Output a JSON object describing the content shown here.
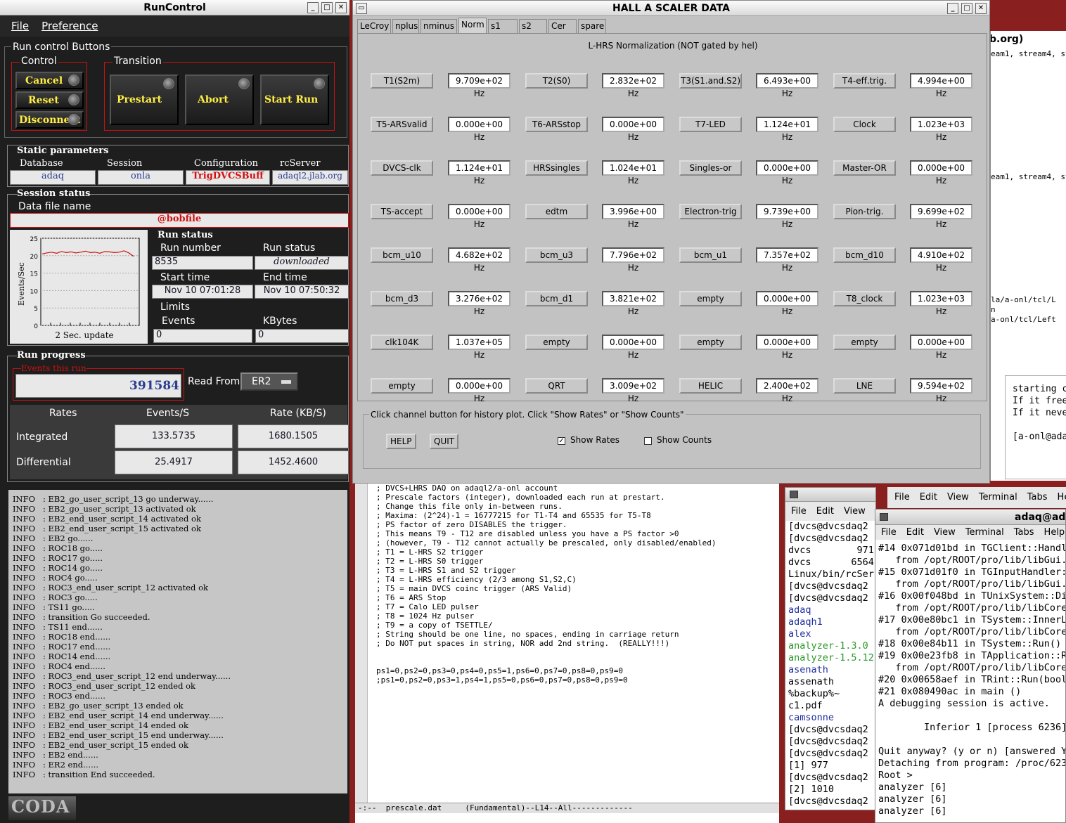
{
  "runcontrol": {
    "title": "RunControl",
    "menu": [
      "File",
      "Preference"
    ],
    "buttons_group": "Run control Buttons",
    "control_label": "Control",
    "transition_label": "Transition",
    "control_buttons": [
      "Cancel",
      "Reset",
      "Disconnect"
    ],
    "transition_buttons": [
      "Prestart",
      "Abort",
      "Start Run"
    ],
    "static_params_label": "Static parameters",
    "params": [
      {
        "label": "Database",
        "value": "adaq"
      },
      {
        "label": "Session",
        "value": "onla"
      },
      {
        "label": "Configuration",
        "value": "TrigDVCSBuff"
      },
      {
        "label": "rcServer",
        "value": "adaql2.jlab.org"
      }
    ],
    "session_status_label": "Session status",
    "data_file_label": "Data file name",
    "data_file_value": "@bobfile",
    "plot": {
      "ylabel": "Events/Sec",
      "ticks": [
        "25",
        "20",
        "15",
        "10",
        "5",
        "0"
      ],
      "caption": "2 Sec. update",
      "values": [
        20.5,
        20.8,
        21.0,
        20.7,
        21.2,
        20.9,
        21.1,
        20.8,
        21.0,
        21.3,
        20.9,
        21.0,
        20.7,
        21.2,
        21.1,
        20.9,
        21.0,
        21.4,
        20.8,
        19.8
      ]
    },
    "run_status_label": "Run status",
    "run_number_label": "Run number",
    "run_number": "8535",
    "run_status_field_label": "Run status",
    "run_status": "downloaded",
    "start_time_label": "Start time",
    "start_time": "Nov 10 07:01:28",
    "end_time_label": "End time",
    "end_time": "Nov 10 07:50:32",
    "limits_label": "Limits",
    "events_label": "Events",
    "events_value": "0",
    "kbytes_label": "KBytes",
    "kbytes_value": "0",
    "run_progress_label": "Run progress",
    "events_this_run_label": "Events this run",
    "events_this_run": "391584",
    "read_from_label": "Read From:",
    "read_from": "ER2",
    "rates_header": [
      "Rates",
      "Events/S",
      "Rate (KB/S)"
    ],
    "rates": [
      {
        "label": "Integrated",
        "events": "133.5735",
        "kb": "1680.1505"
      },
      {
        "label": "Differential",
        "events": "25.4917",
        "kb": "1452.4600"
      }
    ],
    "log": [
      "INFO   : EB2_go_user_script_13 go underway......",
      "INFO   : EB2_go_user_script_13 activated ok",
      "INFO   : EB2_end_user_script_14 activated ok",
      "INFO   : EB2_end_user_script_15 activated ok",
      "INFO   : EB2 go......",
      "INFO   : ROC18 go.....",
      "INFO   : ROC17 go.....",
      "INFO   : ROC14 go.....",
      "INFO   : ROC4 go.....",
      "INFO   : ROC3_end_user_script_12 activated ok",
      "INFO   : ROC3 go.....",
      "INFO   : TS11 go.....",
      "INFO   : transition Go succeeded.",
      "INFO   : TS11 end......",
      "INFO   : ROC18 end......",
      "INFO   : ROC17 end......",
      "INFO   : ROC14 end......",
      "INFO   : ROC4 end......",
      "INFO   : ROC3_end_user_script_12 end underway......",
      "INFO   : ROC3_end_user_script_12 ended ok",
      "INFO   : ROC3 end......",
      "INFO   : EB2_go_user_script_13 ended ok",
      "INFO   : EB2_end_user_script_14 end underway......",
      "INFO   : EB2_end_user_script_14 ended ok",
      "INFO   : EB2_end_user_script_15 end underway......",
      "INFO   : EB2_end_user_script_15 ended ok",
      "INFO   : EB2 end......",
      "INFO   : ER2 end......",
      "INFO   : transition End succeeded."
    ],
    "logo": "CODA"
  },
  "scaler": {
    "title": "HALL  A   SCALER   DATA",
    "tabs": [
      "LeCroy",
      "nplus",
      "nminus",
      "Norm",
      "s1",
      "s2",
      "Cer",
      "spare"
    ],
    "active_tab": "Norm",
    "heading": "L-HRS Normalization (NOT gated by hel)",
    "rows": [
      [
        [
          "T1(S2m)",
          "9.709e+02 Hz"
        ],
        [
          "T2(S0)",
          "2.832e+02 Hz"
        ],
        [
          "T3(S1.and.S2)",
          "6.493e+00 Hz"
        ],
        [
          "T4-eff.trig.",
          "4.994e+00 Hz"
        ]
      ],
      [
        [
          "T5-ARSvalid",
          "0.000e+00 Hz"
        ],
        [
          "T6-ARSstop",
          "0.000e+00 Hz"
        ],
        [
          "T7-LED",
          "1.124e+01 Hz"
        ],
        [
          "Clock",
          "1.023e+03 Hz"
        ]
      ],
      [
        [
          "DVCS-clk",
          "1.124e+01 Hz"
        ],
        [
          "HRSsingles",
          "1.024e+01 Hz"
        ],
        [
          "Singles-or",
          "0.000e+00 Hz"
        ],
        [
          "Master-OR",
          "0.000e+00 Hz"
        ]
      ],
      [
        [
          "TS-accept",
          "0.000e+00 Hz"
        ],
        [
          "edtm",
          "3.996e+00 Hz"
        ],
        [
          "Electron-trig",
          "9.739e+00 Hz"
        ],
        [
          "Pion-trig.",
          "9.699e+02 Hz"
        ]
      ],
      [
        [
          "bcm_u10",
          "4.682e+02 Hz"
        ],
        [
          "bcm_u3",
          "7.796e+02 Hz"
        ],
        [
          "bcm_u1",
          "7.357e+02 Hz"
        ],
        [
          "bcm_d10",
          "4.910e+02 Hz"
        ]
      ],
      [
        [
          "bcm_d3",
          "3.276e+02 Hz"
        ],
        [
          "bcm_d1",
          "3.821e+02 Hz"
        ],
        [
          "empty",
          "0.000e+00 Hz"
        ],
        [
          "T8_clock",
          "1.023e+03 Hz"
        ]
      ],
      [
        [
          "clk104K",
          "1.037e+05 Hz"
        ],
        [
          "empty",
          "0.000e+00 Hz"
        ],
        [
          "empty",
          "0.000e+00 Hz"
        ],
        [
          "empty",
          "0.000e+00 Hz"
        ]
      ],
      [
        [
          "empty",
          "0.000e+00 Hz"
        ],
        [
          "QRT",
          "3.009e+02 Hz"
        ],
        [
          "HELIC",
          "2.400e+02 Hz"
        ],
        [
          "LNE",
          "9.594e+02 Hz"
        ]
      ]
    ],
    "config_note": "Click channel button for history plot.  Click \"Show Rates\" or \"Show Counts\"",
    "help": "HELP",
    "quit": "QUIT",
    "show_rates": "Show Rates",
    "show_counts": "Show Counts"
  },
  "emacs": {
    "lines": [
      "; DVCS+LHRS DAQ on adaql2/a-onl account",
      "; Prescale factors (integer), downloaded each run at prestart.",
      "; Change this file only in-between runs.",
      "; Maxima: (2^24)-1 = 16777215 for T1-T4 and 65535 for T5-T8",
      "; PS factor of zero DISABLES the trigger.",
      "; This means T9 - T12 are disabled unless you have a PS factor >0",
      "; (however, T9 - T12 cannot actually be prescaled, only disabled/enabled)",
      "; T1 = L-HRS S2 trigger",
      "; T2 = L-HRS S0 trigger",
      "; T3 = L-HRS S1 and S2 trigger",
      "; T4 = L-HRS efficiency (2/3 among S1,S2,C)",
      "; T5 = main DVCS coinc trigger (ARS Valid)",
      "; T6 = ARS Stop",
      "; T7 = Calo LED pulser",
      "; T8 = 1024 Hz pulser",
      "; T9 = a copy of TSETTLE/",
      "; String should be one line, no spaces, ending in carriage return",
      "; Do NOT put spaces in string, NOR add 2nd string.  (REALLY!!!)",
      "",
      "",
      "ps1=0,ps2=0,ps3=0,ps4=0,ps5=1,ps6=0,ps7=0,ps8=0,ps9=0",
      ";ps1=0,ps2=0,ps3=1,ps4=1,ps5=0,ps6=0,ps7=0,ps8=0,ps9=0"
    ],
    "modeline": "-:--  prescale.dat     (Fundamental)--L14--All-------------"
  },
  "bg_window": {
    "title_fragment": "b.org)",
    "lines": [
      "eam1, stream4, stre",
      "eam1, stream4, str",
      "la/a-onl/tcl/L",
      "n",
      "a-onl/tcl/Left"
    ],
    "console": [
      "starting c",
      "If it free",
      "If it neve",
      "",
      "[a-onl@ada"
    ]
  },
  "term1": {
    "menu": [
      "File",
      "Edit",
      "View"
    ],
    "lines": [
      "[dvcs@dvcsdaq2",
      "[dvcs@dvcsdaq2",
      "dvcs        971",
      "dvcs       6564",
      "Linux/bin/rcSer",
      "[dvcs@dvcsdaq2",
      "[dvcs@dvcsdaq2",
      "adaq",
      "adaqh1",
      "alex",
      "analyzer-1.3.0",
      "analyzer-1.5.12",
      "asenath",
      "assenath",
      "%backup%~",
      "c1.pdf",
      "camsonne",
      "[dvcs@dvcsdaq2",
      "[dvcs@dvcsdaq2",
      "[dvcs@dvcsdaq2",
      "[1] 977",
      "[dvcs@dvcsdaq2",
      "[2] 1010",
      "[dvcs@dvcsdaq2"
    ]
  },
  "term2": {
    "title": "adaq@ada",
    "outer_menu": [
      "File",
      "Edit",
      "View",
      "Terminal",
      "Tabs",
      "He"
    ],
    "menu": [
      "File",
      "Edit",
      "View",
      "Terminal",
      "Tabs",
      "Help"
    ],
    "lines": [
      "#14 0x071d01bd in TGClient::Handle",
      "   from /opt/ROOT/pro/lib/libGui.s",
      "#15 0x071d01f0 in TGInputHandler:",
      "   from /opt/ROOT/pro/lib/libGui.s",
      "#16 0x00f048bd in TUnixSystem::Dis",
      "   from /opt/ROOT/pro/lib/libCore",
      "#17 0x00e80bc1 in TSystem::InnerLo",
      "   from /opt/ROOT/pro/lib/libCore",
      "#18 0x00e84b11 in TSystem::Run() (",
      "#19 0x00e23fb8 in TApplication::Ru",
      "   from /opt/ROOT/pro/lib/libCore",
      "#20 0x00658aef in TRint::Run(bool)",
      "#21 0x080490ac in main ()",
      "A debugging session is active.",
      "",
      "        Inferior 1 [process 6236]",
      "",
      "Quit anyway? (y or n) [answered Y",
      "Detaching from program: /proc/6236",
      "Root >",
      "analyzer [6]",
      "analyzer [6]",
      "analyzer [6] "
    ]
  }
}
